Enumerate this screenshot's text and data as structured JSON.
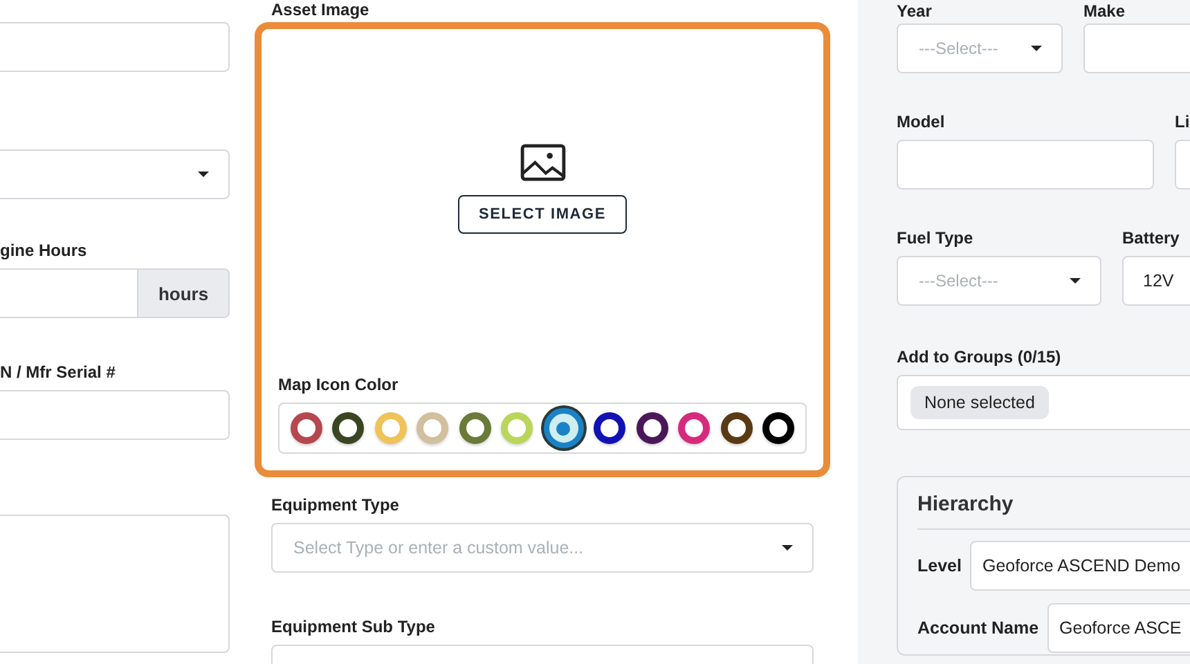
{
  "left_column": {
    "engine_hours_label": "gine Hours",
    "engine_hours_unit": "hours",
    "serial_label": "N / Mfr Serial #"
  },
  "asset_image": {
    "label": "Asset Image",
    "button": "SELECT IMAGE",
    "highlighted": true
  },
  "map_icon_color": {
    "label": "Map Icon Color",
    "swatches": [
      {
        "color": "#b5484f",
        "selected": false
      },
      {
        "color": "#3b4522",
        "selected": false
      },
      {
        "color": "#f0c35a",
        "selected": false
      },
      {
        "color": "#d2bf9e",
        "selected": false
      },
      {
        "color": "#6a7a38",
        "selected": false
      },
      {
        "color": "#b9d65a",
        "selected": false
      },
      {
        "color": "#1a82c6",
        "selected": true
      },
      {
        "color": "#1212b4",
        "selected": false
      },
      {
        "color": "#4a1858",
        "selected": false
      },
      {
        "color": "#d82a7c",
        "selected": false
      },
      {
        "color": "#5a3a12",
        "selected": false
      },
      {
        "color": "#000000",
        "selected": false
      }
    ]
  },
  "equipment_type": {
    "label": "Equipment Type",
    "placeholder": "Select Type or enter a custom value..."
  },
  "equipment_sub_type": {
    "label": "Equipment Sub Type"
  },
  "right_column": {
    "year_label": "Year",
    "year_placeholder": "---Select---",
    "make_label": "Make",
    "model_label": "Model",
    "li_label": "Li",
    "fuel_type_label": "Fuel Type",
    "fuel_type_placeholder": "---Select---",
    "battery_label": "Battery",
    "battery_value": "12V",
    "groups_label": "Add to Groups (0/15)",
    "groups_chip": "None selected"
  },
  "hierarchy": {
    "title": "Hierarchy",
    "level_label": "Level",
    "level_value": "Geoforce ASCEND Demo",
    "account_label": "Account Name",
    "account_value": "Geoforce ASCE"
  }
}
